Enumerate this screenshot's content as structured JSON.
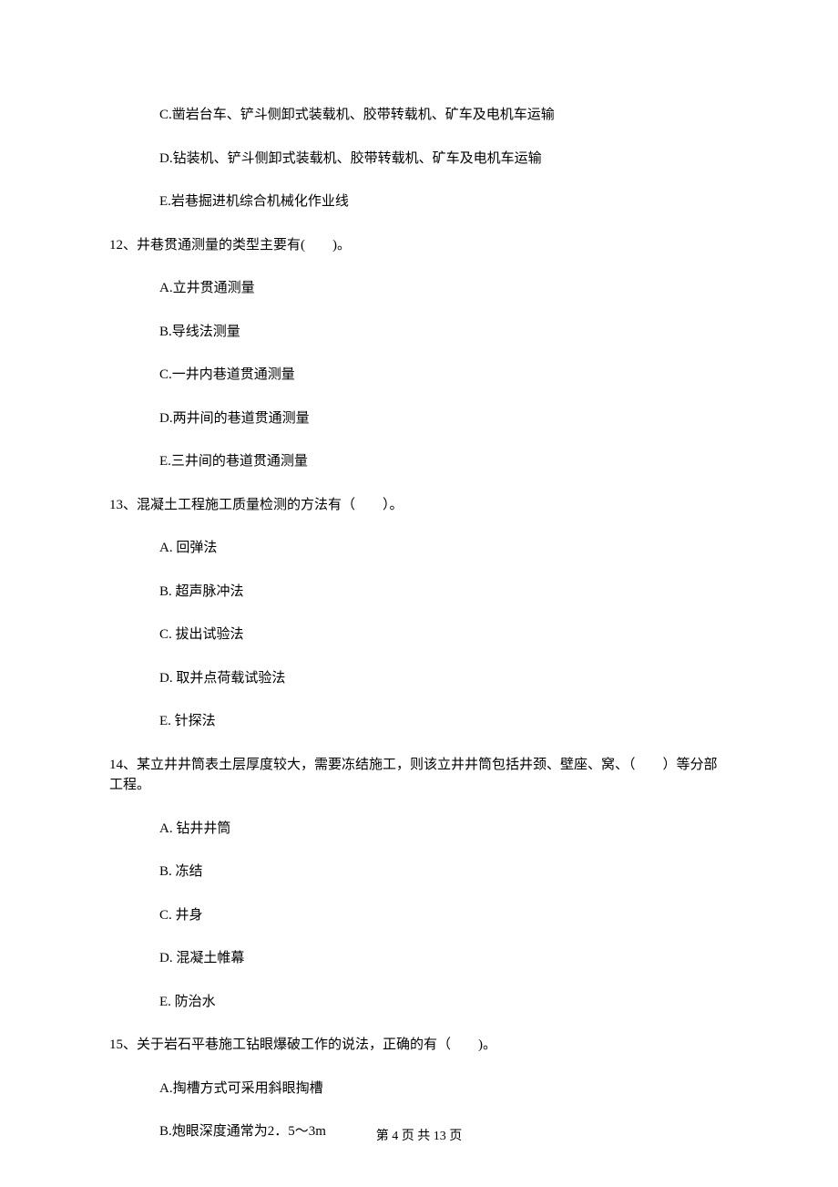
{
  "q11_tail_options": {
    "C": "C.凿岩台车、铲斗侧卸式装载机、胶带转载机、矿车及电机车运输",
    "D": "D.钻装机、铲斗侧卸式装载机、胶带转载机、矿车及电机车运输",
    "E": "E.岩巷掘进机综合机械化作业线"
  },
  "q12": {
    "stem": "12、井巷贯通测量的类型主要有(　　)。",
    "A": "A.立井贯通测量",
    "B": "B.导线法测量",
    "C": "C.一井内巷道贯通测量",
    "D": "D.两井间的巷道贯通测量",
    "E": "E.三井间的巷道贯通测量"
  },
  "q13": {
    "stem": "13、混凝土工程施工质量检测的方法有（　　）。",
    "A": "A. 回弹法",
    "B": "B. 超声脉冲法",
    "C": "C. 拔出试验法",
    "D": "D. 取并点荷载试验法",
    "E": "E. 针探法"
  },
  "q14": {
    "stem": "14、某立井井筒表土层厚度较大，需要冻结施工，则该立井井筒包括井颈、壁座、窝、（　　）等分部工程。",
    "A": "A. 钻井井筒",
    "B": "B. 冻结",
    "C": "C. 井身",
    "D": "D. 混凝土帷幕",
    "E": "E. 防治水"
  },
  "q15": {
    "stem": "15、关于岩石平巷施工钻眼爆破工作的说法，正确的有（　　)。",
    "A": "A.掏槽方式可采用斜眼掏槽",
    "B": "B.炮眼深度通常为2．5～3m"
  },
  "footer": "第 4 页 共 13 页"
}
